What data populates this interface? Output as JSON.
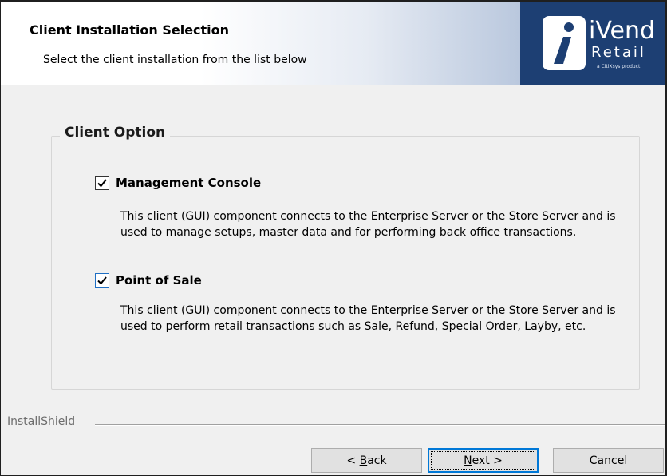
{
  "header": {
    "title": "Client Installation Selection",
    "subtitle": "Select the client installation from the list below"
  },
  "logo": {
    "brand": "iVend",
    "product": "Retail",
    "tagline": "a CitiXsys product"
  },
  "group": {
    "title": "Client Option",
    "options": [
      {
        "label": "Management Console",
        "checked": true,
        "description": "This client (GUI) component connects to the Enterprise Server or the Store Server and is used to manage setups, master data and for performing back office transactions."
      },
      {
        "label": "Point of Sale",
        "checked": true,
        "description": "This client (GUI) component connects to the Enterprise Server or the Store Server and is used to perform retail transactions such as Sale, Refund, Special Order, Layby, etc."
      }
    ]
  },
  "footer": {
    "brand": "InstallShield",
    "back_prefix": "< ",
    "back_accel": "B",
    "back_rest": "ack",
    "next_accel": "N",
    "next_rest": "ext >",
    "cancel": "Cancel"
  },
  "colors": {
    "logo_bg": "#1d3f73",
    "checkbox_border": "#333333",
    "default_button_border": "#0078d7"
  }
}
